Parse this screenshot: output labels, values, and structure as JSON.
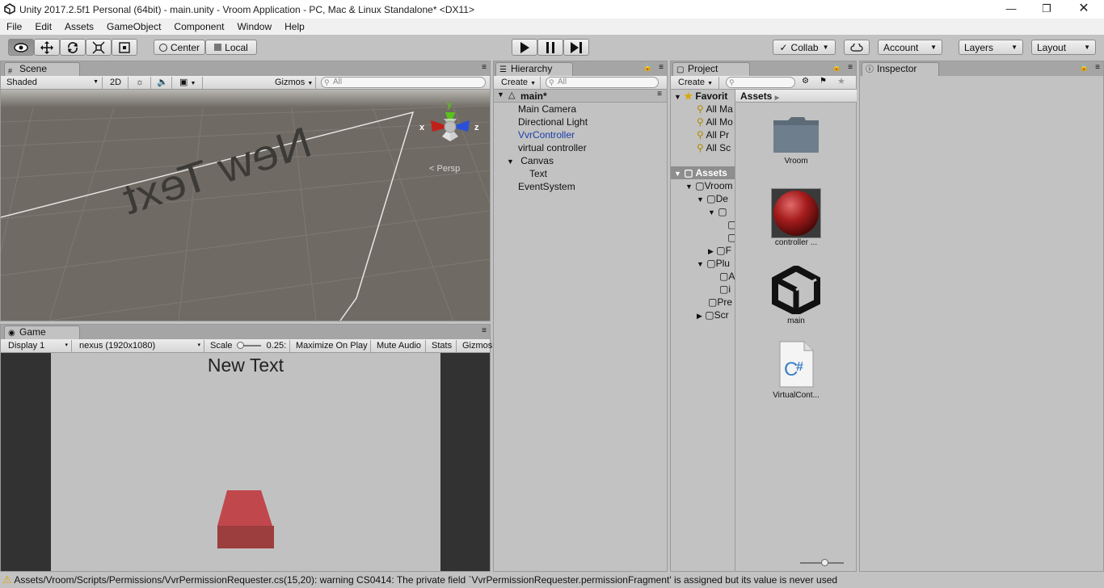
{
  "window": {
    "title": "Unity 2017.2.5f1 Personal (64bit) - main.unity - Vroom Application - PC, Mac & Linux Standalone* <DX11>"
  },
  "menu": [
    "File",
    "Edit",
    "Assets",
    "GameObject",
    "Component",
    "Window",
    "Help"
  ],
  "toolbar": {
    "pivot": "Center",
    "space": "Local",
    "collab": "Collab",
    "account": "Account",
    "layers": "Layers",
    "layout": "Layout"
  },
  "scene": {
    "tab": "Scene",
    "shading": "Shaded",
    "mode_2d": "2D",
    "gizmos": "Gizmos",
    "search_placeholder": "All",
    "text_mesh": "New Text",
    "persp": "Persp",
    "axis_y": "y",
    "axis_x": "x",
    "axis_z": "z"
  },
  "game": {
    "tab": "Game",
    "display": "Display 1",
    "resolution": "nexus (1920x1080)",
    "scale_label": "Scale",
    "scale_value": "0.25:",
    "maximize": "Maximize On Play",
    "mute": "Mute Audio",
    "stats": "Stats",
    "gizmos": "Gizmos",
    "ui_text": "New Text"
  },
  "hierarchy": {
    "tab": "Hierarchy",
    "create": "Create",
    "search_placeholder": "All",
    "scene_name": "main*",
    "items": [
      {
        "label": "Main Camera"
      },
      {
        "label": "Directional Light"
      },
      {
        "label": "VvrController"
      },
      {
        "label": "virtual controller"
      },
      {
        "label": "Canvas"
      },
      {
        "label": "Text"
      },
      {
        "label": "EventSystem"
      }
    ]
  },
  "project": {
    "tab": "Project",
    "create": "Create",
    "favorites_label": "Favorit",
    "favorites": [
      "All Ma",
      "All Mo",
      "All Pr",
      "All Sc"
    ],
    "assets_label": "Assets",
    "tree": [
      "Vroom",
      "De",
      "",
      "",
      "",
      "F",
      "Plu",
      "A",
      "i",
      "Pre",
      "Scr"
    ],
    "breadcrumb": "Assets",
    "assets": [
      {
        "name": "Vroom",
        "icon": "folder-icon"
      },
      {
        "name": "controller ...",
        "icon": "material-sphere-icon"
      },
      {
        "name": "main",
        "icon": "unity-scene-icon"
      },
      {
        "name": "VirtualCont...",
        "icon": "csharp-script-icon"
      }
    ]
  },
  "inspector": {
    "tab": "Inspector"
  },
  "status": {
    "message": "Assets/Vroom/Scripts/Permissions/VvrPermissionRequester.cs(15,20): warning CS0414: The private field `VvrPermissionRequester.permissionFragment' is assigned but its value is never used"
  },
  "colors": {
    "selected_text": "#1a3ea8",
    "scene_bg": "#6f6a63",
    "game_bg": "#c1c1c1",
    "axis_x": "#c0201a",
    "axis_y": "#59c21c",
    "axis_z": "#2b4fd6",
    "cube": "#c0474c"
  }
}
